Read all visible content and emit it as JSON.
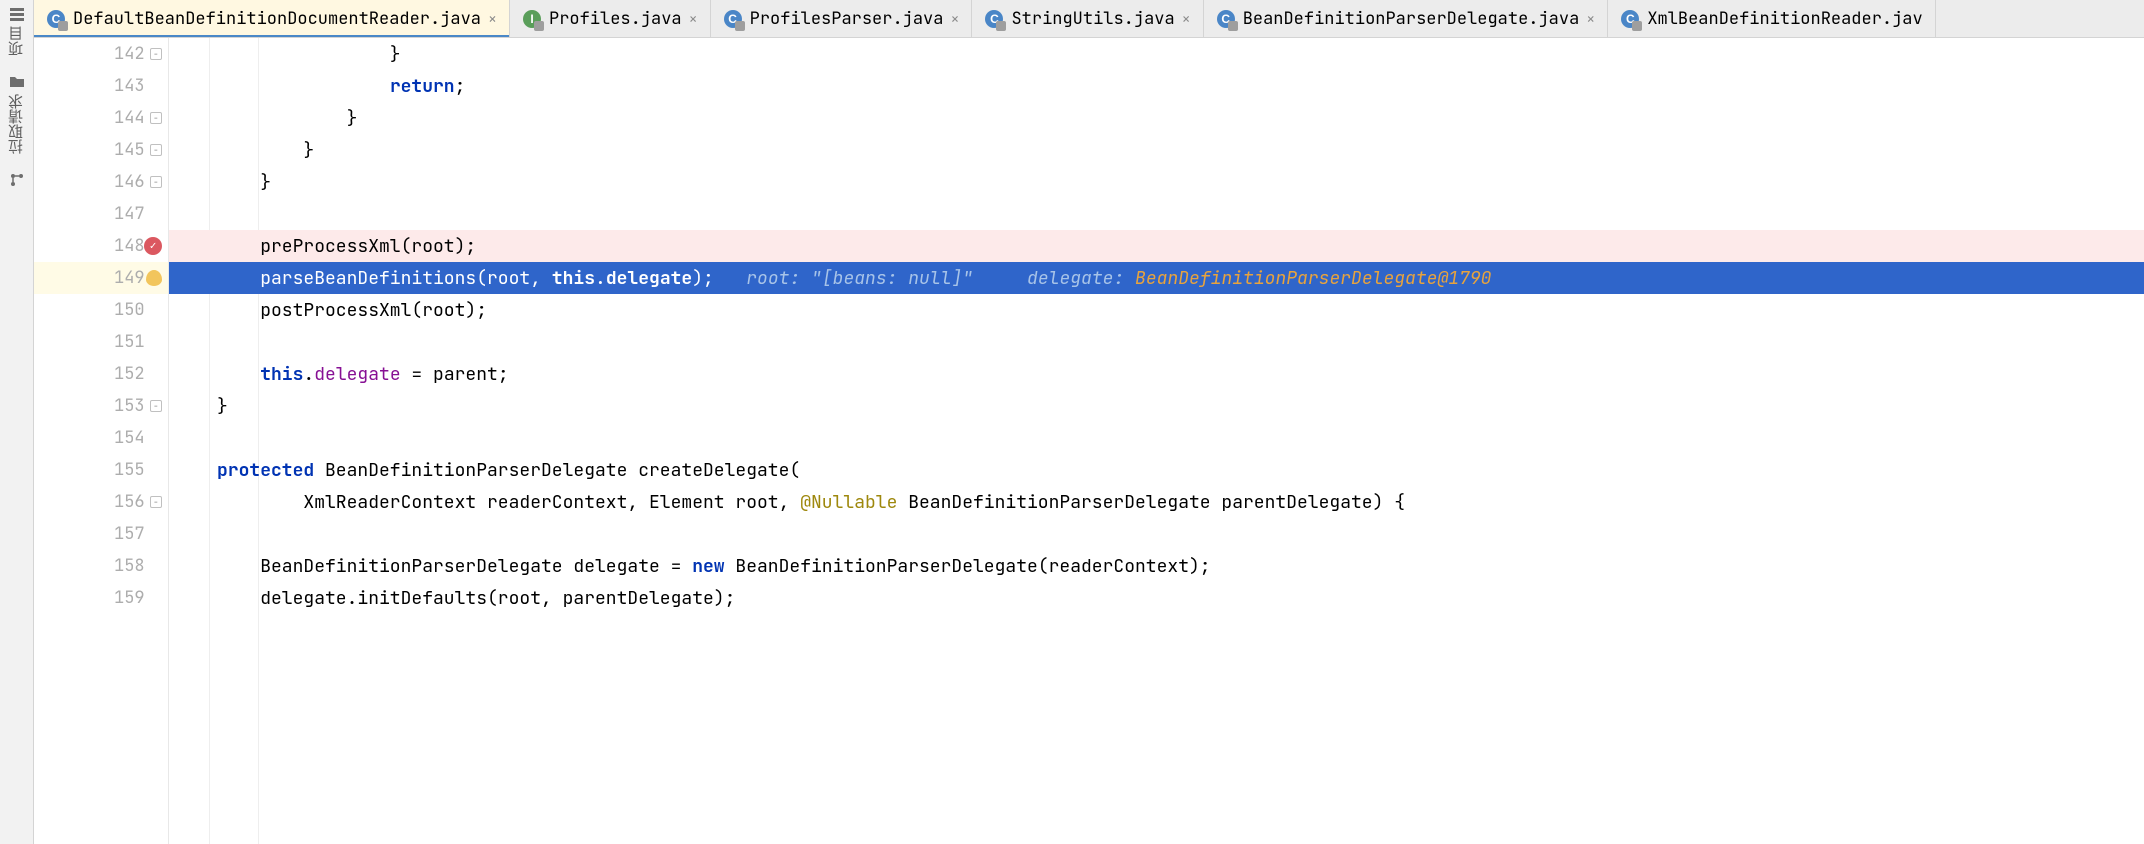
{
  "tools": {
    "t0": {
      "label": "项目"
    },
    "t1": {
      "label": "拉取请求"
    }
  },
  "tabs": [
    {
      "name": "DefaultBeanDefinitionDocumentReader.java",
      "icon": "C",
      "iconClass": "icon-c",
      "active": true
    },
    {
      "name": "Profiles.java",
      "icon": "I",
      "iconClass": "icon-i",
      "active": false
    },
    {
      "name": "ProfilesParser.java",
      "icon": "C",
      "iconClass": "icon-c",
      "active": false
    },
    {
      "name": "StringUtils.java",
      "icon": "C",
      "iconClass": "icon-c",
      "active": false
    },
    {
      "name": "BeanDefinitionParserDelegate.java",
      "icon": "C",
      "iconClass": "icon-c",
      "active": false
    },
    {
      "name": "XmlBeanDefinitionReader.jav",
      "icon": "C",
      "iconClass": "icon-c",
      "active": false,
      "noclose": true
    }
  ],
  "close_glyph": "×",
  "gutter": {
    "lines": [
      142,
      143,
      144,
      145,
      146,
      147,
      148,
      149,
      150,
      151,
      152,
      153,
      154,
      155,
      156,
      157,
      158,
      159
    ],
    "folds_minus": [
      142,
      144,
      145,
      146,
      153,
      156
    ],
    "bp_line": 148,
    "exec_line": 149
  },
  "code": {
    "l142": "                }",
    "l143_a": "                ",
    "l143_kw": "return",
    "l143_b": ";",
    "l144": "            }",
    "l145": "        }",
    "l146": "    }",
    "l147": "",
    "l148": "    preProcessXml(root);",
    "l149_a": "    parseBeanD",
    "l149_b": "efinitions(root, ",
    "l149_kw": "this",
    "l149_c": ".",
    "l149_field": "delegate",
    "l149_d": ");",
    "l149_hint1": "   root: ",
    "l149_hint1v": "\"[beans: null]\"",
    "l149_hint2": "     delegate: ",
    "l149_hint2v": "BeanDefinitionParserDelegate@1790",
    "l150": "    postProcessXml(root);",
    "l151": "",
    "l152_a": "    ",
    "l152_kw": "this",
    "l152_b": ".",
    "l152_field": "delegate",
    "l152_c": " = parent;",
    "l153": "}",
    "l154": "",
    "l155_kw": "protected",
    "l155_a": " BeanDefinitionParserDelegate createDelegate(",
    "l156_a": "        XmlReaderContext readerContext, Element root, ",
    "l156_anno": "@Nullable",
    "l156_b": " BeanDefinitionParserDelegate parentDelegate) {",
    "l157": "",
    "l158_a": "    BeanDefinitionParserDelegate delegate = ",
    "l158_kw": "new",
    "l158_b": " BeanDefinitionParserDelegate(readerContext);",
    "l159": "    delegate.initDefaults(root, parentDelegate);"
  }
}
